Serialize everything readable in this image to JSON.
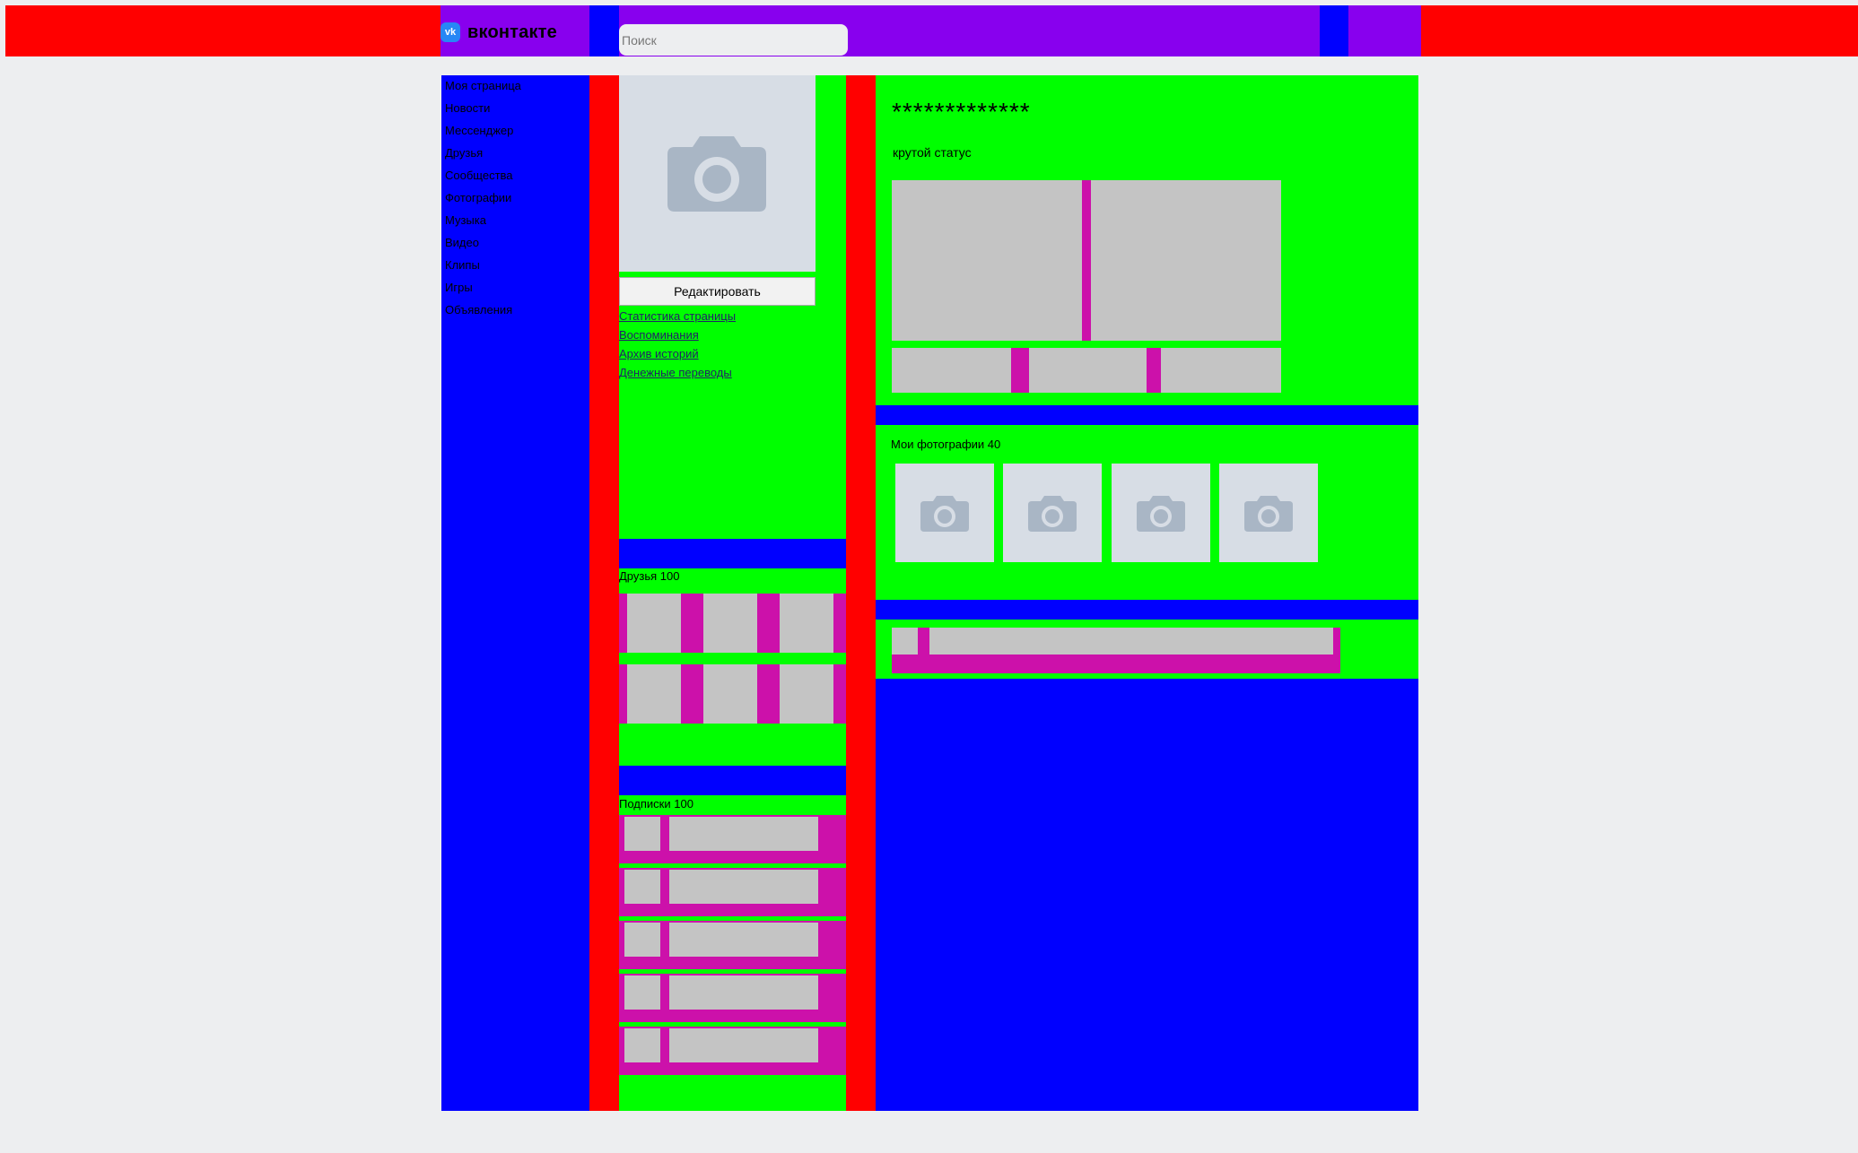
{
  "header": {
    "logo_text": "вконтакте",
    "logo_mark": "vk",
    "search_placeholder": "Поиск"
  },
  "menu": {
    "items": [
      "Моя страница",
      "Новости",
      "Мессенджер",
      "Друзья",
      "Сообщества",
      "Фотографии",
      "Музыка",
      "Видео",
      "Клипы",
      "Игры",
      "Объявления"
    ]
  },
  "profile": {
    "edit_label": "Редактировать",
    "links": [
      "Статистика страницы",
      "Воспоминания",
      "Архив историй",
      "Денежные переводы"
    ],
    "name": "*************",
    "status": "крутой статус"
  },
  "friends": {
    "label": "Друзья 100"
  },
  "subscriptions": {
    "label": "Подписки 100"
  },
  "photos": {
    "label": "Мои фотографии 40"
  },
  "colors": {
    "red": "#ff0000",
    "purple": "#8800ee",
    "blue": "#0000ff",
    "green": "#00ff00",
    "magenta": "#cc11aa",
    "gray": "#c4c4c4",
    "page_bg": "#edeef0",
    "placeholder_bg": "#d7dde5",
    "camera": "#a9b6c5"
  }
}
